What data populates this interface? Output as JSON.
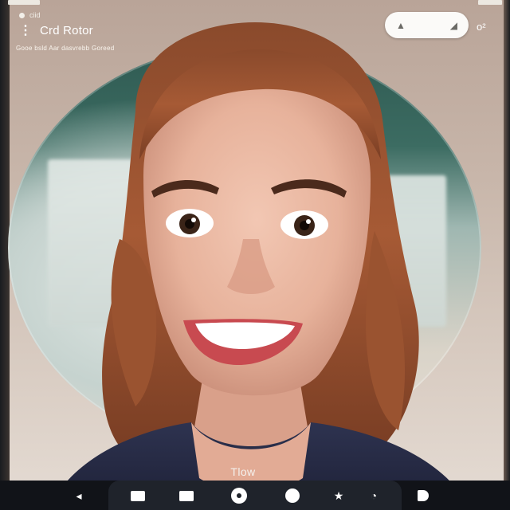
{
  "status": {
    "indicator_label": "ciid"
  },
  "header": {
    "menu_icon": "kebab-icon",
    "title": "Crd Rotor",
    "subtitle": "Gooe bsld Aar dasvrebb Goreed"
  },
  "search": {
    "left_glyph": "▲",
    "right_glyph": "◢",
    "icon_names": [
      "search-pill-left-icon",
      "search-pill-right-icon"
    ]
  },
  "corner": {
    "glyph": "o²"
  },
  "photo": {
    "caption": "Tlow",
    "backdrop_colors": {
      "teal": "#2f5a52",
      "wall": "#b9a498"
    }
  },
  "bottom_nav": {
    "items": [
      {
        "name": "back-icon",
        "glyph": "◂"
      },
      {
        "name": "folder-icon"
      },
      {
        "name": "gallery-icon"
      },
      {
        "name": "shutter-icon"
      },
      {
        "name": "record-icon"
      },
      {
        "name": "star-icon",
        "glyph": "★"
      },
      {
        "name": "timer-icon",
        "glyph": "◔"
      },
      {
        "name": "settings-icon"
      }
    ],
    "colors": {
      "bar": "#111318",
      "dock": "#1f232b"
    }
  }
}
